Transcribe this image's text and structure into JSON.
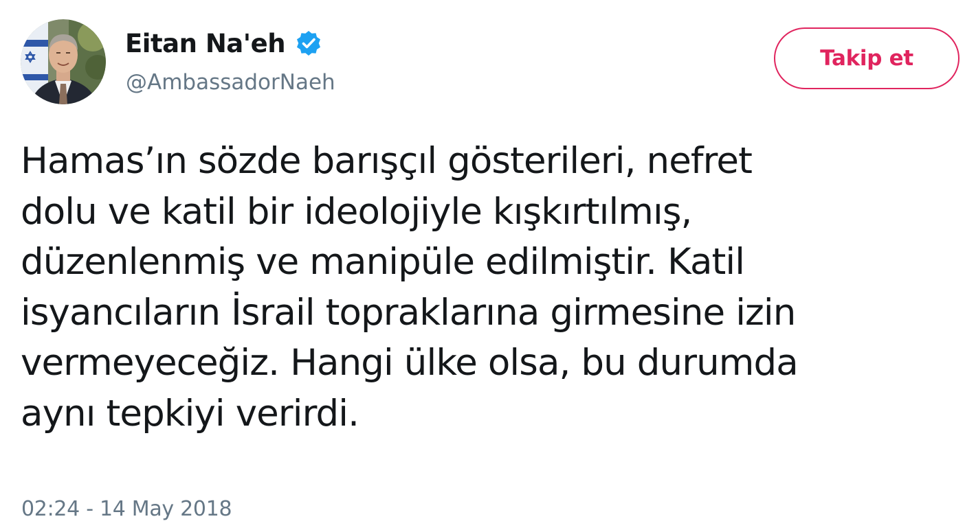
{
  "author": {
    "display_name": "Eitan Na'eh",
    "handle": "@AmbassadorNaeh",
    "verified": true,
    "avatar_icon": "profile-photo"
  },
  "follow_button": {
    "label": "Takip et"
  },
  "tweet": {
    "text": "Hamas’ın sözde barışçıl gösterileri, nefret\ndolu ve katil bir ideolojiyle kışkırtılmış,\ndüzenlenmiş ve manipüle edilmiştir. Katil\nisyancıların İsrail topraklarına girmesine izin\nvermeyeceğiz. Hangi ülke olsa, bu durumda\naynı tepkiyi verirdi.",
    "timestamp": "02:24 - 14 May 2018"
  },
  "colors": {
    "accent": "#e0245e",
    "verified": "#1da1f2",
    "text": "#14171a",
    "secondary_text": "#657786"
  }
}
